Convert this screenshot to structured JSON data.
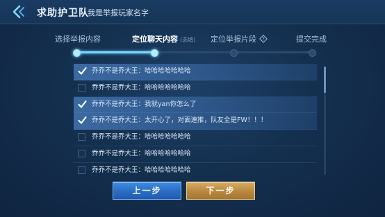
{
  "header": {
    "title": "求助护卫队",
    "subtitle": "我是举报玩家名字"
  },
  "steps": [
    {
      "label": "选择举报内容",
      "hint": "",
      "active": false
    },
    {
      "label": "定位聊天内容",
      "hint": "(选填)",
      "active": true
    },
    {
      "label": "定位举报片段",
      "hint": "",
      "active": false
    },
    {
      "label": "提交完成",
      "hint": "",
      "active": false
    }
  ],
  "progress": {
    "completed_steps": 2,
    "total_steps": 4
  },
  "messages": [
    {
      "text": "乔乔不是乔大王：哈哈哈哈哈哈哈",
      "checked": true
    },
    {
      "text": "乔乔不是乔大王：哈哈哈哈哈哈哈",
      "checked": false
    },
    {
      "text": "乔乔不是乔大王：我就yan你怎么了",
      "checked": true
    },
    {
      "text": "乔乔不是乔大王：太开心了，对面速推，队友全是FW！！！",
      "checked": true
    },
    {
      "text": "乔乔不是乔大王：哈哈哈哈哈哈哈",
      "checked": false
    },
    {
      "text": "乔乔不是乔大王：哈哈哈哈哈哈哈",
      "checked": false
    },
    {
      "text": "乔乔不是乔大王：哈哈哈哈哈哈哈",
      "checked": false
    }
  ],
  "buttons": {
    "prev": "上一步",
    "next": "下一步"
  },
  "colors": {
    "accent": "#7fd4ff",
    "prev_button": "#2a6cc2",
    "next_button": "#b9883f"
  }
}
